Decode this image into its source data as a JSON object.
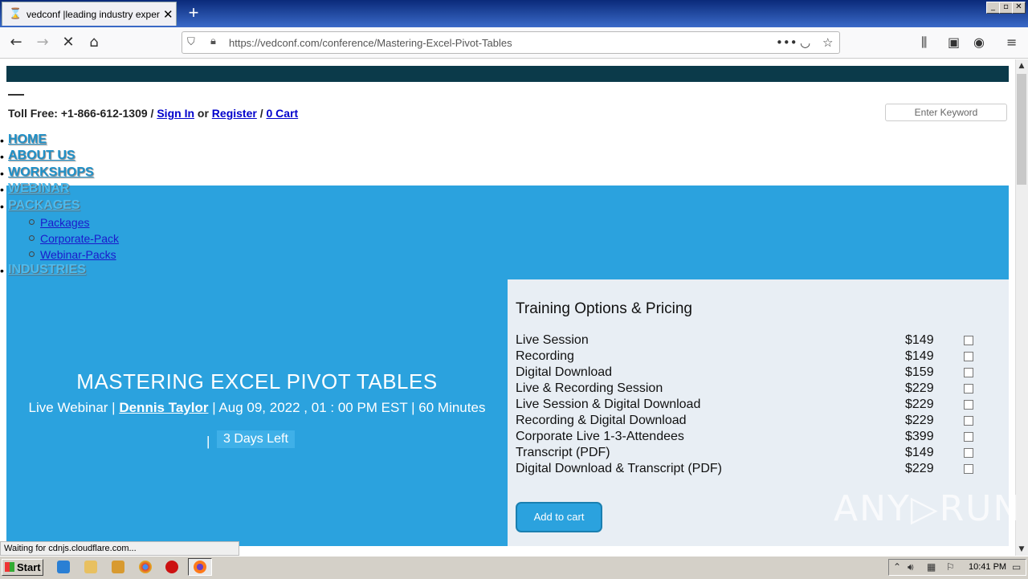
{
  "browser": {
    "tab_title": "vedconf |leading industry experts",
    "tab_favicon": "⌛",
    "new_tab": "+",
    "url": "https://vedconf.com/conference/Mastering-Excel-Pivot-Tables",
    "window_buttons": [
      "_",
      "▫",
      "✕"
    ],
    "status_text": "Waiting for cdnjs.cloudflare.com..."
  },
  "header": {
    "toll_free": "Toll Free: +1-866-612-1309 /",
    "sign_in": "Sign In",
    "or": "or",
    "register": "Register",
    "sep": "/",
    "cart": "0 Cart",
    "search_placeholder": "Enter Keyword"
  },
  "menu": {
    "items": [
      "HOME",
      "ABOUT US",
      "WORKSHOPS",
      "WEBINAR",
      "PACKAGES",
      "INDUSTRIES"
    ],
    "packages_sub": [
      "Packages",
      "Corporate-Pack",
      "Webinar-Packs"
    ]
  },
  "hero": {
    "title": "MASTERING EXCEL PIVOT TABLES",
    "prefix": "Live Webinar |",
    "speaker": "Dennis Taylor",
    "details": "| Aug 09, 2022 , 01 : 00 PM EST | 60 Minutes",
    "sep": "|",
    "days_left": "3 Days Left"
  },
  "pricing": {
    "heading": "Training Options & Pricing",
    "options": [
      {
        "name": "Live Session",
        "price": "$149"
      },
      {
        "name": "Recording",
        "price": "$149"
      },
      {
        "name": "Digital Download",
        "price": "$159"
      },
      {
        "name": "Live & Recording Session",
        "price": "$229"
      },
      {
        "name": "Live Session & Digital Download",
        "price": "$229"
      },
      {
        "name": "Recording & Digital Download",
        "price": "$229"
      },
      {
        "name": "Corporate Live 1-3-Attendees",
        "price": "$399"
      },
      {
        "name": "Transcript (PDF)",
        "price": "$149"
      },
      {
        "name": "Digital Download & Transcript (PDF)",
        "price": "$229"
      }
    ],
    "add_to_cart": "Add to cart"
  },
  "watermark": "ANY▷RUN",
  "taskbar": {
    "start": "Start",
    "clock": "10:41 PM"
  },
  "colors": {
    "brand_blue": "#2ba2de",
    "dark_band": "#0b3a4a",
    "pricing_bg": "#e8eef4"
  }
}
